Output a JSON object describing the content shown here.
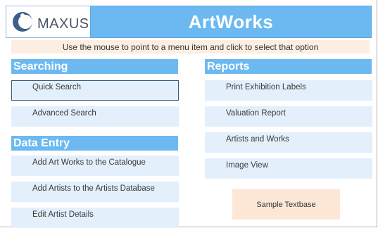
{
  "header": {
    "logo_text": "MAXUS",
    "title": "ArtWorks",
    "instruction": "Use the mouse to point to a menu item and click to select that option"
  },
  "searching": {
    "header": "Searching",
    "items": [
      {
        "label": "Quick Search"
      },
      {
        "label": "Advanced Search"
      }
    ]
  },
  "data_entry": {
    "header": "Data Entry",
    "items": [
      {
        "label": "Add Art Works to the Catalogue"
      },
      {
        "label": "Add Artists to the Artists Database"
      },
      {
        "label": "Edit Artist Details"
      }
    ]
  },
  "reports": {
    "header": "Reports",
    "items": [
      {
        "label": "Print Exhibition Labels"
      },
      {
        "label": "Valuation Report"
      },
      {
        "label": "Artists and Works"
      },
      {
        "label": "Image View"
      }
    ]
  },
  "sample": {
    "label": "Sample Textbase"
  },
  "colors": {
    "header_blue": "#6bb9f0",
    "button_bg": "#e3f0fc",
    "instruction_bg": "#fdeee2",
    "sample_bg": "#fde7d7"
  }
}
